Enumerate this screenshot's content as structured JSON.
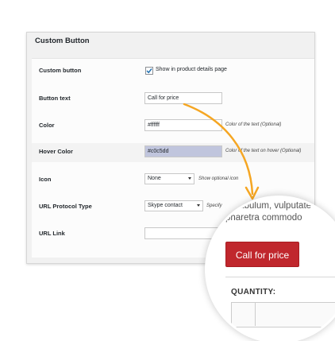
{
  "panel": {
    "title": "Custom Button"
  },
  "rows": {
    "custom_button": {
      "label": "Custom button",
      "checked": true,
      "checkbox_label": "Show in product details page"
    },
    "button_text": {
      "label": "Button text",
      "value": "Call for price"
    },
    "color": {
      "label": "Color",
      "value": "#ffffff",
      "hint": "Color of the text (Optional)"
    },
    "hover_color": {
      "label": "Hover Color",
      "value": "#c0c5dd",
      "hint": "Color of the text on hover (Optional)"
    },
    "icon": {
      "label": "Icon",
      "selected": "None",
      "hint": "Show optional icon"
    },
    "url_protocol": {
      "label": "URL Protocol Type",
      "selected": "Skype contact",
      "hint": "Specify"
    },
    "url_link": {
      "label": "URL Link",
      "value": ""
    }
  },
  "preview": {
    "text_line1": "vestibulum, vulputate",
    "text_line2": "pharetra commodo",
    "button_label": "Call for price",
    "quantity_label": "QUANTITY:"
  },
  "colors": {
    "accent_button": "#c0272d",
    "arrow": "#f5a623",
    "hover_field": "#c0c5dd"
  }
}
